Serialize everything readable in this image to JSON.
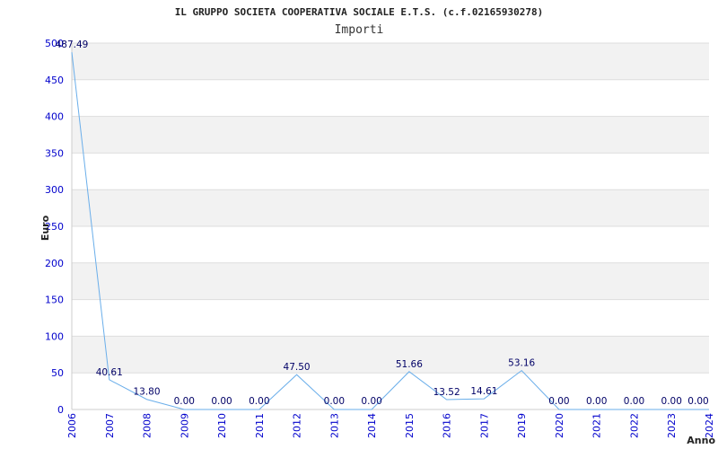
{
  "chart_data": {
    "type": "line",
    "title": "IL GRUPPO SOCIETA COOPERATIVA SOCIALE E.T.S. (c.f.02165930278)",
    "subtitle": "Importi",
    "xlabel": "Anno",
    "ylabel": "Euro",
    "ylim": [
      0,
      500
    ],
    "yticks": [
      "0",
      "50",
      "100",
      "150",
      "200",
      "250",
      "300",
      "350",
      "400",
      "450",
      "500"
    ],
    "grid": true,
    "categories": [
      "2006",
      "2007",
      "2008",
      "2009",
      "2010",
      "2011",
      "2012",
      "2013",
      "2014",
      "2015",
      "2016",
      "2017",
      "2019",
      "2020",
      "2021",
      "2022",
      "2023",
      "2024"
    ],
    "values": [
      487.49,
      40.61,
      13.8,
      0.0,
      0.0,
      0.0,
      47.5,
      0.0,
      0.0,
      51.66,
      13.52,
      14.61,
      53.16,
      0.0,
      0.0,
      0.0,
      0.0,
      0.0
    ],
    "value_labels": [
      "487.49",
      "40.61",
      "13.80",
      "0.00",
      "0.00",
      "0.00",
      "47.50",
      "0.00",
      "0.00",
      "51.66",
      "13.52",
      "14.61",
      "53.16",
      "0.00",
      "0.00",
      "0.00",
      "0.00",
      "0.00"
    ],
    "colors": {
      "line": "#6aaeea",
      "band": "#f2f2f2",
      "grid": "#dddddd",
      "tick_text": "#0000cc",
      "label_text": "#000066"
    }
  }
}
